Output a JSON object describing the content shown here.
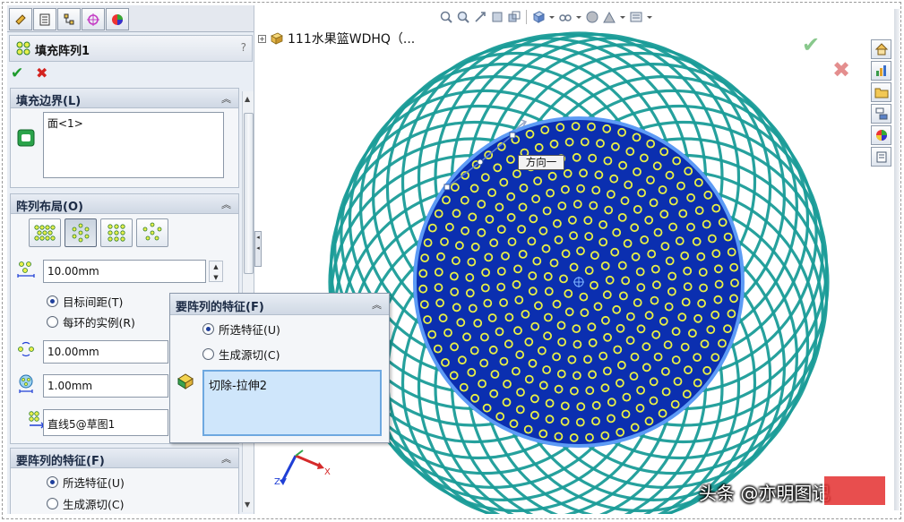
{
  "panel": {
    "title": "填充阵列1",
    "help": "?",
    "ok": "✔",
    "cancel": "✖"
  },
  "fill_boundary": {
    "header": "填充边界(L)",
    "items": [
      "面<1>"
    ]
  },
  "pattern_layout": {
    "header": "阵列布局(O)",
    "layout_buttons": [
      "perforation",
      "circular",
      "square",
      "polygon"
    ],
    "spacing": "10.00mm",
    "radio_target_spacing": "目标间距(T)",
    "radio_instances_per_ring": "每环的实例(R)",
    "instance_spacing": "10.00mm",
    "margin": "1.00mm",
    "direction": "直线5@草图1"
  },
  "features_bottom": {
    "header": "要阵列的特征(F)",
    "radio_selected": "所选特征(U)",
    "radio_generate": "生成源切(C)"
  },
  "features_popup": {
    "header": "要阵列的特征(F)",
    "radio_selected": "所选特征(U)",
    "radio_generate": "生成源切(C)",
    "selected_items": [
      "切除-拉伸2"
    ]
  },
  "tree": {
    "model_name": "111水果篮WDHQ（..."
  },
  "viewport": {
    "direction_label": "方向一",
    "axis_x": "X",
    "axis_z": "Z"
  },
  "watermark": {
    "text": "头条 @亦明图记"
  },
  "colors": {
    "face_blue": "#0b2fb0",
    "hole_yellow": "#e9f044",
    "basket_teal": "#1a9c98",
    "accept_green": "#1e9b2c",
    "cancel_red": "#d3231f"
  }
}
